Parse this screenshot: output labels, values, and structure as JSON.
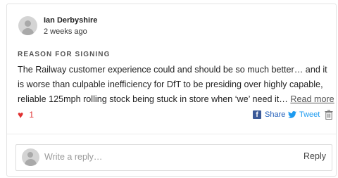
{
  "comment": {
    "author": "Ian Derbyshire",
    "timestamp": "2 weeks ago",
    "section_label": "REASON FOR SIGNING",
    "text": "The Railway customer experience could and should be so much better… and it is worse than culpable inefficiency for DfT to be presiding over highly capable, reliable 125mph rolling stock being stuck in store when ‘we’ need it…",
    "read_more": "Read more",
    "like_count": "1"
  },
  "actions": {
    "share_label": "Share",
    "tweet_label": "Tweet"
  },
  "reply": {
    "placeholder": "Write a reply…",
    "button_label": "Reply"
  },
  "colors": {
    "heart": "#e03131",
    "facebook": "#3b5998",
    "twitter": "#1d9bf0"
  },
  "icons": [
    "avatar-icon",
    "heart-icon",
    "facebook-icon",
    "twitter-icon",
    "trash-icon"
  ]
}
